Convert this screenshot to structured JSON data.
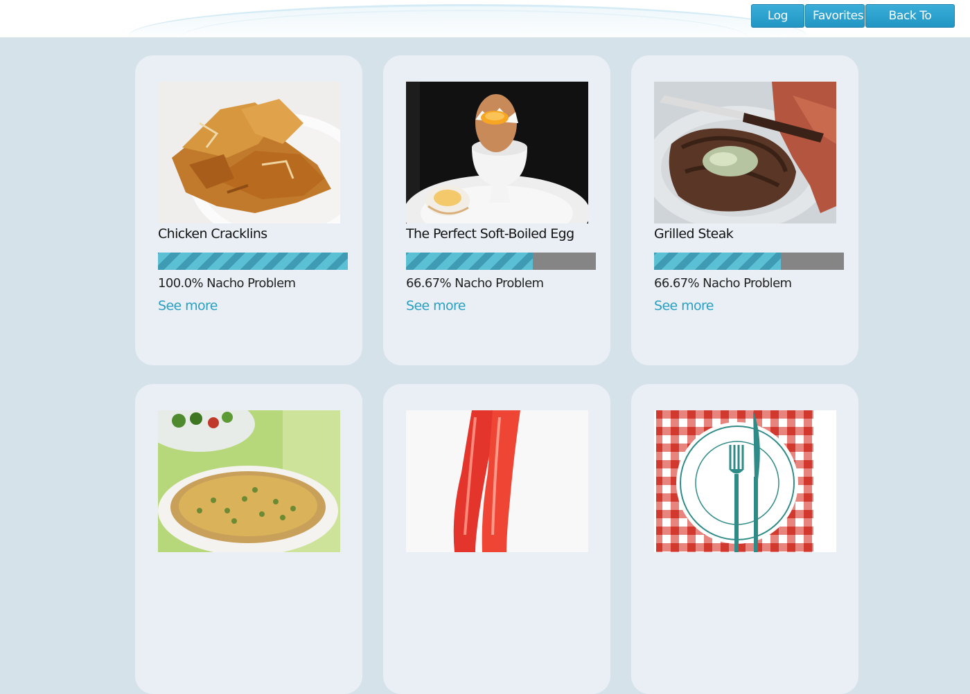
{
  "nav": {
    "logout": "Log out",
    "favorites": "Favorites",
    "back": "Back To Pantry"
  },
  "recipes": [
    {
      "title": "Chicken Cracklins",
      "match": 100.0,
      "match_text": "100.0% Nacho Problem",
      "link": "See more",
      "image": "fried-chicken-skins-photo"
    },
    {
      "title": "The Perfect Soft-Boiled Egg",
      "match": 66.67,
      "match_text": "66.67% Nacho Problem",
      "link": "See more",
      "image": "soft-boiled-egg-photo"
    },
    {
      "title": "Grilled Steak",
      "match": 66.67,
      "match_text": "66.67% Nacho Problem",
      "link": "See more",
      "image": "grilled-steak-photo"
    },
    {
      "title": "",
      "match": null,
      "match_text": "",
      "link": "",
      "image": "quiche-photo"
    },
    {
      "title": "",
      "match": null,
      "match_text": "",
      "link": "",
      "image": "red-jello-photo"
    },
    {
      "title": "",
      "match": null,
      "match_text": "",
      "link": "",
      "image": "plate-fork-knife-placeholder"
    }
  ],
  "colors": {
    "page_bg": "#d6e2ea",
    "card_bg": "#e9eff4",
    "button": "#2a9fc9",
    "link": "#2a9fc4",
    "bar_fill": "#5bc0d3",
    "bar_track": "#858585"
  }
}
